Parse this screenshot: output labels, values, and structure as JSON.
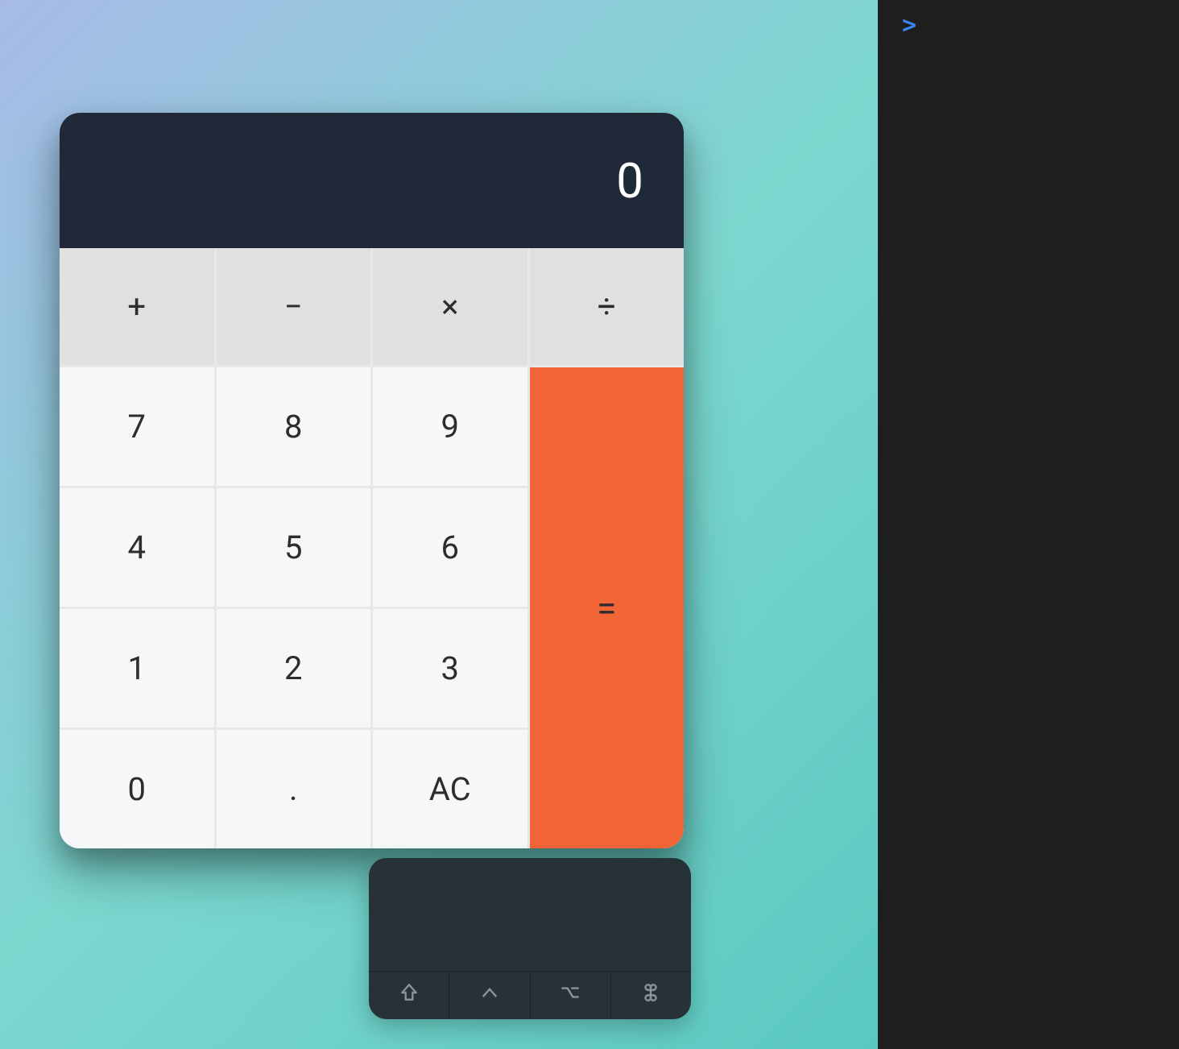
{
  "calculator": {
    "display_value": "0",
    "operators": {
      "add": "+",
      "subtract": "−",
      "multiply": "×",
      "divide": "÷"
    },
    "numbers": {
      "n7": "7",
      "n8": "8",
      "n9": "9",
      "n4": "4",
      "n5": "5",
      "n6": "6",
      "n1": "1",
      "n2": "2",
      "n3": "3",
      "n0": "0",
      "dot": "."
    },
    "clear_label": "AC",
    "equals_label": "=",
    "colors": {
      "display_bg": "#1f2937",
      "operator_bg": "#e0e0e0",
      "number_bg": "#f5f7f9",
      "equals_bg": "#f16537"
    }
  },
  "devtools": {
    "prompt": ">"
  },
  "osk": {
    "mods": {
      "shift": "shift",
      "ctrl": "ctrl",
      "alt": "alt",
      "cmd": "cmd"
    }
  }
}
